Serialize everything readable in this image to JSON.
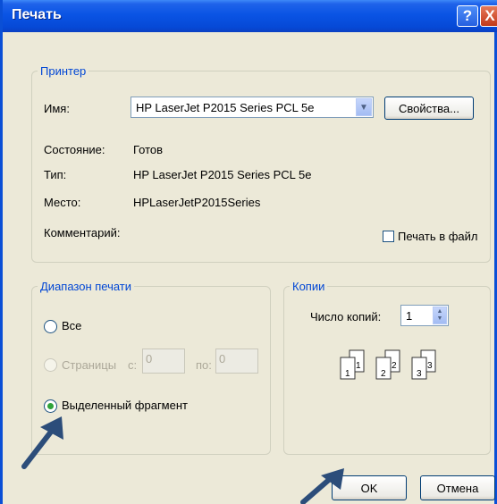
{
  "window": {
    "title": "Печать",
    "help_icon": "?",
    "close_icon": "X"
  },
  "printer": {
    "legend": "Принтер",
    "name_label": "Имя:",
    "name_value": "HP LaserJet P2015 Series PCL 5e",
    "properties_button": "Свойства...",
    "status_label": "Состояние:",
    "status_value": "Готов",
    "type_label": "Тип:",
    "type_value": "HP LaserJet P2015 Series PCL 5e",
    "location_label": "Место:",
    "location_value": "HPLaserJetP2015Series",
    "comment_label": "Комментарий:",
    "print_to_file_label": "Печать в файл",
    "print_to_file_checked": false
  },
  "range": {
    "legend": "Диапазон печати",
    "all_label": "Все",
    "pages_label": "Страницы",
    "from_label": "с:",
    "from_value": "0",
    "to_label": "по:",
    "to_value": "0",
    "selection_label": "Выделенный фрагмент",
    "selected": "selection"
  },
  "copies": {
    "legend": "Копии",
    "count_label": "Число копий:",
    "count_value": "1",
    "collate_pages": [
      "1",
      "1",
      "2",
      "2",
      "3",
      "3"
    ]
  },
  "buttons": {
    "ok": "OK",
    "cancel": "Отмена"
  },
  "colors": {
    "title_bar": "#0a54e4",
    "group_legend": "#0046d5",
    "dialog_bg": "#ece9d8",
    "annotation_arrow": "#2c4d7a"
  }
}
